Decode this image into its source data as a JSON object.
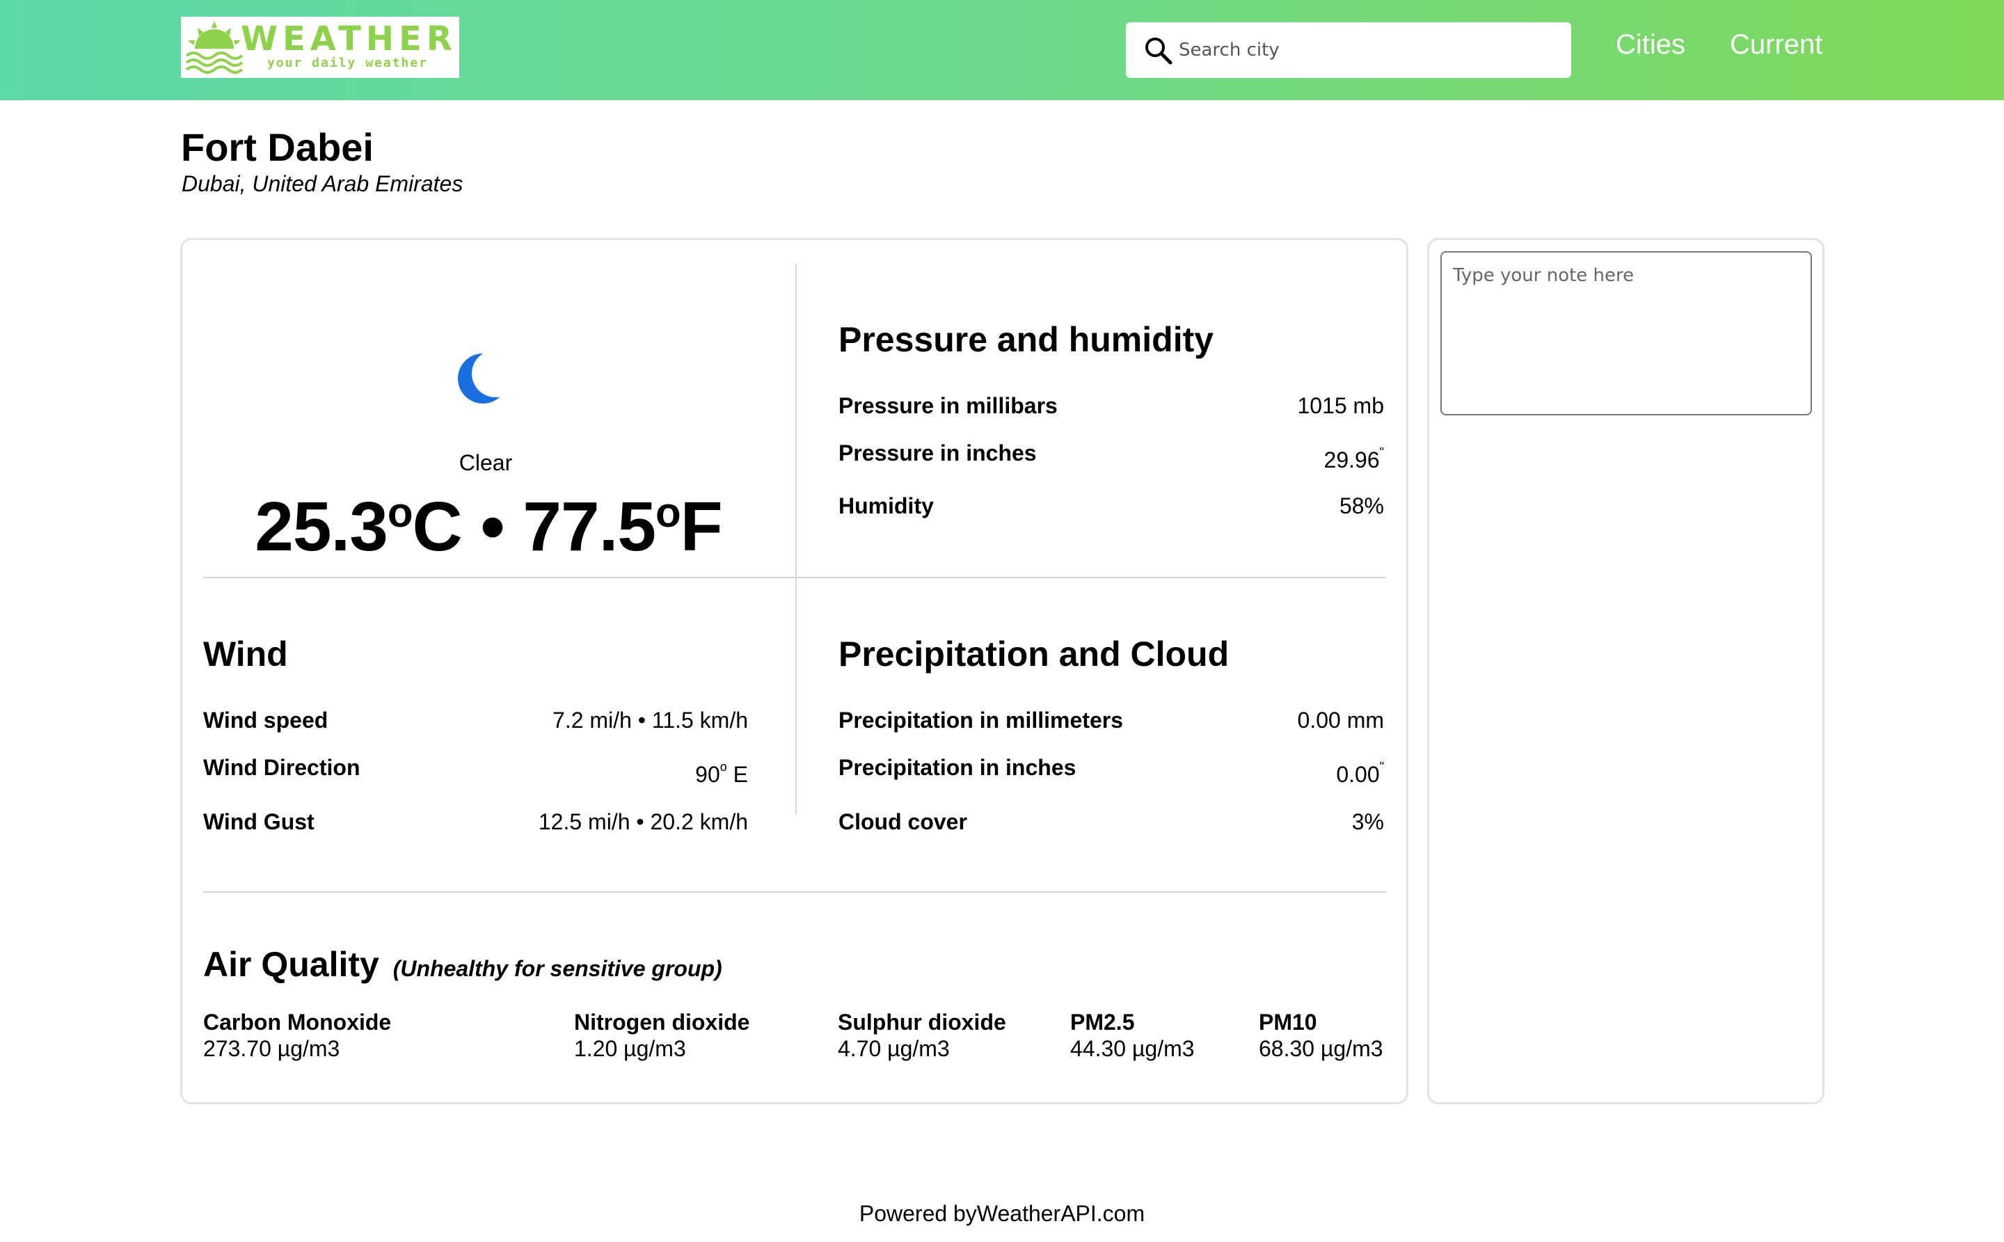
{
  "header": {
    "logo": {
      "word": "WEATHER",
      "tagline": "your daily weather"
    },
    "search": {
      "placeholder": "Search city"
    },
    "nav": {
      "cities": "Cities",
      "current": "Current"
    }
  },
  "location": {
    "name": "Fort Dabei",
    "region": "Dubai, United Arab Emirates"
  },
  "current": {
    "condition": "Clear",
    "temp_c": "25.3",
    "temp_f": "77.5",
    "degree_sign": "o",
    "unit_c": "C",
    "unit_f": "F",
    "separator": "•"
  },
  "pressure_humidity": {
    "title": "Pressure and humidity",
    "rows": [
      {
        "label": "Pressure in millibars",
        "value": "1015 mb"
      },
      {
        "label": "Pressure in inches",
        "value": "29.96",
        "suffix": "\""
      },
      {
        "label": "Humidity",
        "value": "58%"
      }
    ]
  },
  "wind": {
    "title": "Wind",
    "rows": [
      {
        "label": "Wind speed",
        "value": "7.2 mi/h • 11.5 km/h"
      },
      {
        "label": "Wind Direction",
        "value_deg": "90",
        "deg_sign": "o",
        "value_dir": " E"
      },
      {
        "label": "Wind Gust",
        "value": "12.5 mi/h • 20.2 km/h"
      }
    ]
  },
  "precipitation": {
    "title": "Precipitation and Cloud",
    "rows": [
      {
        "label": "Precipitation in millimeters",
        "value": "0.00 mm"
      },
      {
        "label": "Precipitation in inches",
        "value": "0.00",
        "suffix": "\""
      },
      {
        "label": "Cloud cover",
        "value": "3%"
      }
    ]
  },
  "air_quality": {
    "title": "Air Quality",
    "status": "(Unhealthy for sensitive group)",
    "items": [
      {
        "label": "Carbon Monoxide",
        "value": "273.70 µg/m3"
      },
      {
        "label": "Nitrogen dioxide",
        "value": "1.20 µg/m3"
      },
      {
        "label": "Sulphur dioxide",
        "value": "4.70 µg/m3"
      },
      {
        "label": "PM2.5",
        "value": "44.30 µg/m3"
      },
      {
        "label": "PM10",
        "value": "68.30 µg/m3"
      }
    ]
  },
  "note": {
    "placeholder": "Type your note here"
  },
  "footer": {
    "text": "Powered byWeatherAPI.com"
  },
  "colors": {
    "header_start": "#5bd9a6",
    "header_end": "#7ed958",
    "logo": "#8ed14a",
    "moon": "#1a6fe0"
  },
  "icons": {
    "search": "search-icon",
    "condition": "moon-icon",
    "logo": "sun-logo-icon"
  }
}
